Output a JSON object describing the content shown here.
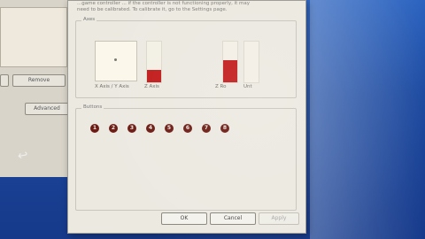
{
  "background_window": {
    "remove_label": "Remove",
    "advanced_label": "Advanced"
  },
  "dialog": {
    "header_line1": "...game controller ... if the controller is not functioning properly, it may",
    "header_line2": "need to be calibrated. To calibrate it, go to the Settings page."
  },
  "axes": {
    "legend": "Axes",
    "xy_label": "X Axis / Y Axis",
    "z_label": "Z Axis",
    "r_label": "Z Ro",
    "u_label": "Unt",
    "z_level": 0.3,
    "r_level": 0.55
  },
  "buttons": {
    "legend": "Buttons",
    "items": [
      "1",
      "2",
      "3",
      "4",
      "5",
      "6",
      "7",
      "8"
    ]
  },
  "footer": {
    "ok_label": "OK",
    "cancel_label": "Cancel",
    "apply_label": "Apply"
  },
  "colors": {
    "bar_fill": "#c21a1a",
    "button_dot": "#6a1a12",
    "desktop": "#1f4fa8"
  }
}
